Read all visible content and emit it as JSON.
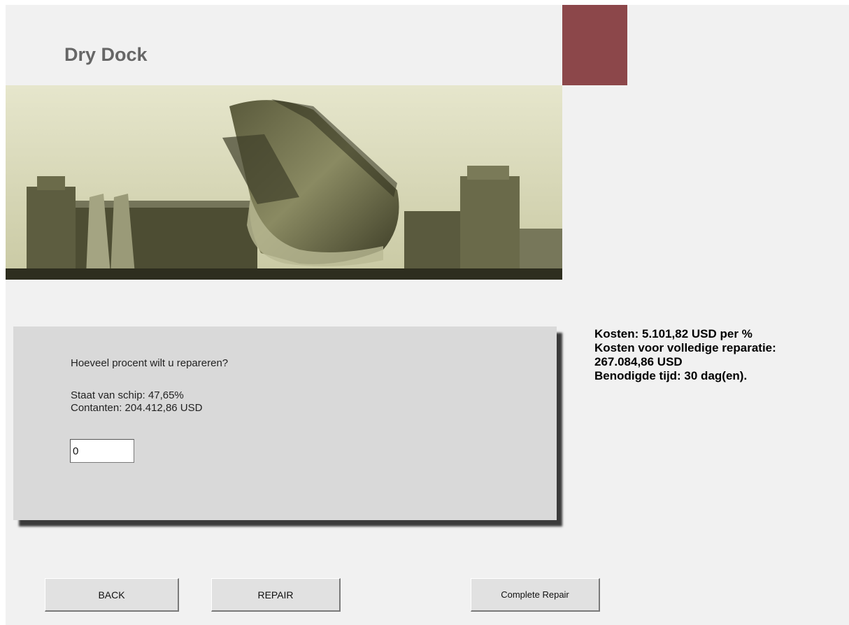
{
  "header": {
    "title": "Dry Dock",
    "accent_color": "#8c474a"
  },
  "banner": {
    "image_subject": "ship-in-dry-dock"
  },
  "repair_panel": {
    "question": "Hoeveel procent wilt u repareren?",
    "ship_condition": "Staat van schip: 47,65%",
    "cash": "Contanten: 204.412,86 USD",
    "percent_input_value": "0"
  },
  "cost_info": {
    "cost_per_percent": "Kosten: 5.101,82 USD per %",
    "full_repair_label": "Kosten voor volledige reparatie:",
    "full_repair_amount": "267.084,86 USD",
    "required_time": "Benodigde tijd: 30 dag(en)."
  },
  "buttons": {
    "back": "BACK",
    "repair": "REPAIR",
    "complete_repair": "Complete Repair"
  }
}
